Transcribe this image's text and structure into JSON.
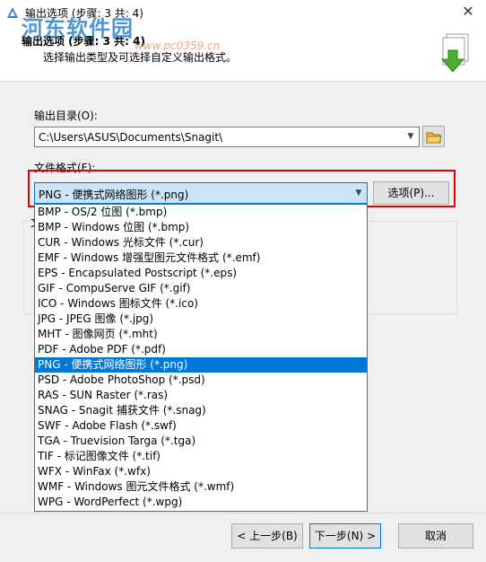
{
  "window": {
    "title": "输出选项 (步骤: 3 共: 4)",
    "close_glyph": "✕"
  },
  "watermark": {
    "text": "河东软件园",
    "url": "www.pc0359.cn"
  },
  "header": {
    "title": "输出选项 (步骤: 3 共: 4)",
    "subtitle": "选择输出类型及可选择自定义输出格式。"
  },
  "output_dir": {
    "label": "输出目录(O):",
    "value": "C:\\Users\\ASUS\\Documents\\Snagit\\"
  },
  "file_format": {
    "label": "文件格式(F):",
    "selected": "PNG - 便携式网络图形 (*.png)",
    "options_button": "选项(P)...",
    "items": [
      "BMP - OS/2 位图 (*.bmp)",
      "BMP - Windows 位图 (*.bmp)",
      "CUR - Windows 光标文件 (*.cur)",
      "EMF - Windows 增强型图元文件格式 (*.emf)",
      "EPS - Encapsulated Postscript (*.eps)",
      "GIF - CompuServe GIF (*.gif)",
      "ICO - Windows 图标文件 (*.ico)",
      "JPG - JPEG 图像 (*.jpg)",
      "MHT - 图像网页 (*.mht)",
      "PDF - Adobe PDF (*.pdf)",
      "PNG - 便携式网络图形 (*.png)",
      "PSD - Adobe PhotoShop (*.psd)",
      "RAS - SUN Raster (*.ras)",
      "SNAG - Snagit 捕获文件 (*.snag)",
      "SWF - Adobe Flash (*.swf)",
      "TGA - Truevision Targa (*.tga)",
      "TIF - 标记图像文件 (*.tif)",
      "WFX - WinFax (*.wfx)",
      "WMF - Windows 图元文件格式 (*.wmf)",
      "WPG - WordPerfect (*.wpg)"
    ],
    "selected_index": 10
  },
  "group": {
    "caption": "文"
  },
  "footer": {
    "back": "< 上一步(B)",
    "next": "下一步(N) >",
    "cancel": "取消"
  },
  "colors": {
    "highlight": "#0078d7",
    "red_box": "#e00000",
    "arrow_green": "#4caf2f"
  }
}
